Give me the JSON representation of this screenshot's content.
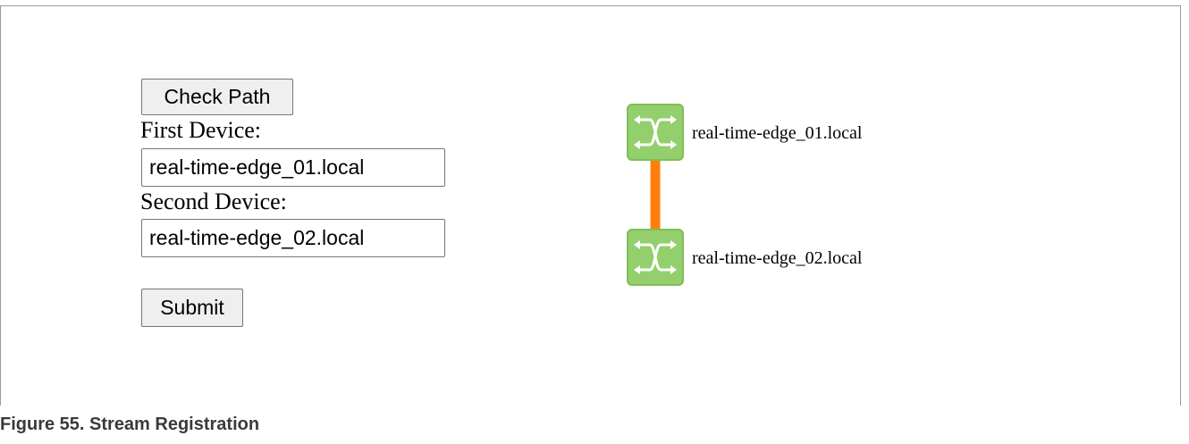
{
  "form": {
    "check_path_label": "Check Path",
    "first_device_label": "First Device:",
    "first_device_value": "real-time-edge_01.local",
    "second_device_label": "Second Device:",
    "second_device_value": "real-time-edge_02.local",
    "submit_label": "Submit"
  },
  "topology": {
    "nodes": [
      {
        "label": "real-time-edge_01.local",
        "icon": "switch-icon"
      },
      {
        "label": "real-time-edge_02.local",
        "icon": "switch-icon"
      }
    ],
    "link_color": "#ff7f0e",
    "node_fill": "#93cf6c",
    "node_border": "#7dbf55"
  },
  "caption": "Figure 55.  Stream Registration"
}
